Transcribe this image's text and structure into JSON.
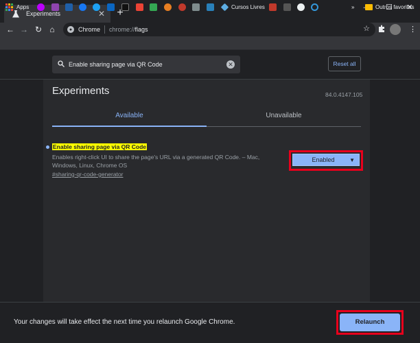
{
  "tab": {
    "title": "Experiments"
  },
  "omnibox": {
    "site": "Chrome",
    "scheme": "chrome://",
    "path": "flags"
  },
  "bookmarks": {
    "apps_label": "Apps",
    "cursos_label": "Cursos Livres",
    "outros_label": "Outros favoritos"
  },
  "search": {
    "value": "Enable sharing page via QR Code"
  },
  "reset_label": "Reset all",
  "experiments": {
    "title": "Experiments",
    "version": "84.0.4147.105",
    "tabs": [
      {
        "label": "Available"
      },
      {
        "label": "Unavailable"
      }
    ]
  },
  "flag": {
    "name": "Enable sharing page via QR Code",
    "description": "Enables right-click UI to share the page's URL via a generated QR Code. – Mac, Windows, Linux, Chrome OS",
    "link": "#sharing-qr-code-generator",
    "value": "Enabled"
  },
  "footer": {
    "message": "Your changes will take effect the next time you relaunch Google Chrome.",
    "relaunch_label": "Relaunch"
  },
  "colors": {
    "accent": "#8ab4f8",
    "highlight": "#ffff00",
    "annotation": "#e8001c"
  }
}
